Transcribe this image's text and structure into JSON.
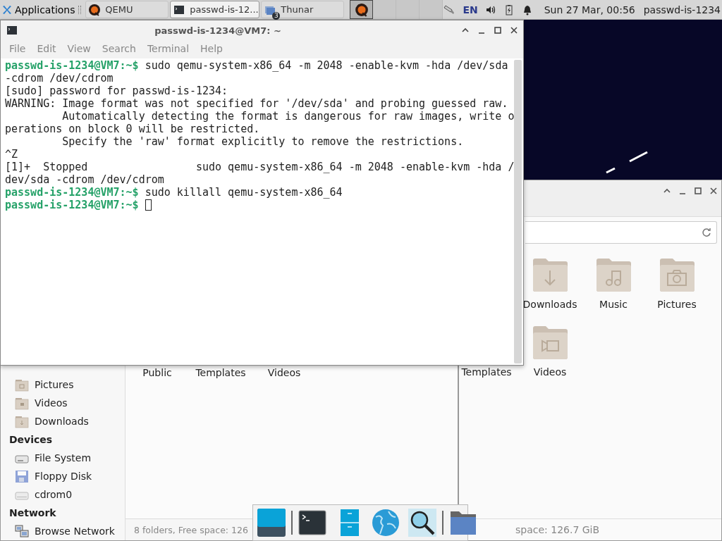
{
  "panel": {
    "apps_menu": "Applications",
    "tasks": [
      {
        "label": "QEMU",
        "kind": "qemu",
        "selected": false
      },
      {
        "label": "passwd-is-12...",
        "kind": "terminal",
        "selected": true
      },
      {
        "label": "Thunar",
        "kind": "folders",
        "badge": "3",
        "selected": false
      }
    ],
    "workspaces": [
      {
        "selected": true,
        "kind": "qemu"
      },
      {
        "selected": false,
        "kind": "empty"
      },
      {
        "selected": false,
        "kind": "empty"
      },
      {
        "selected": false,
        "kind": "empty"
      }
    ],
    "keyboard_layout": "EN",
    "clock": "Sun 27 Mar, 00:56",
    "user": "passwd-is-1234"
  },
  "terminal": {
    "title": "passwd-is-1234@VM7: ~",
    "menu": [
      "File",
      "Edit",
      "View",
      "Search",
      "Terminal",
      "Help"
    ],
    "lines": [
      {
        "prompt": "passwd-is-1234@VM7:~$",
        "text": " sudo qemu-system-x86_64 -m 2048 -enable-kvm -hda /dev/sda",
        "cursor": false
      },
      {
        "text": "-cdrom /dev/cdrom",
        "cursor": false
      },
      {
        "text": "[sudo] password for passwd-is-1234:",
        "cursor": false
      },
      {
        "text": "WARNING: Image format was not specified for '/dev/sda' and probing guessed raw.",
        "cursor": false
      },
      {
        "text": "         Automatically detecting the format is dangerous for raw images, write o",
        "cursor": false
      },
      {
        "text": "perations on block 0 will be restricted.",
        "cursor": false
      },
      {
        "text": "         Specify the 'raw' format explicitly to remove the restrictions.",
        "cursor": false
      },
      {
        "text": "^Z",
        "cursor": false
      },
      {
        "text": "[1]+  Stopped                 sudo qemu-system-x86_64 -m 2048 -enable-kvm -hda /",
        "cursor": false
      },
      {
        "text": "dev/sda -cdrom /dev/cdrom",
        "cursor": false
      },
      {
        "prompt": "passwd-is-1234@VM7:~$",
        "text": " sudo killall qemu-system-x86_64",
        "cursor": false
      },
      {
        "prompt": "passwd-is-1234@VM7:~$",
        "cursor": true
      }
    ]
  },
  "file_manager_back": {
    "sidebar": [
      {
        "items": [
          {
            "label": "Pictures",
            "kind": "pictures"
          },
          {
            "label": "Videos",
            "kind": "videos"
          },
          {
            "label": "Downloads",
            "kind": "downloads"
          }
        ]
      },
      {
        "heading": "Devices",
        "items": [
          {
            "label": "File System",
            "kind": "drive"
          },
          {
            "label": "Floppy Disk",
            "kind": "floppy"
          },
          {
            "label": "cdrom0",
            "kind": "optical"
          }
        ]
      },
      {
        "heading": "Network",
        "items": [
          {
            "label": "Browse Network",
            "kind": "network"
          }
        ]
      }
    ],
    "files": [
      "Public",
      "Templates",
      "Videos"
    ],
    "status": "8 folders, Free space: 126"
  },
  "file_manager_front": {
    "files": [
      {
        "label": "Downloads",
        "kind": "downloads"
      },
      {
        "label": "Music",
        "kind": "music"
      },
      {
        "label": "Pictures",
        "kind": "pictures"
      },
      {
        "label": "Templates",
        "kind": "hidden"
      },
      {
        "label": "Videos",
        "kind": "videos"
      }
    ],
    "status": "space: 126.7 GiB"
  }
}
